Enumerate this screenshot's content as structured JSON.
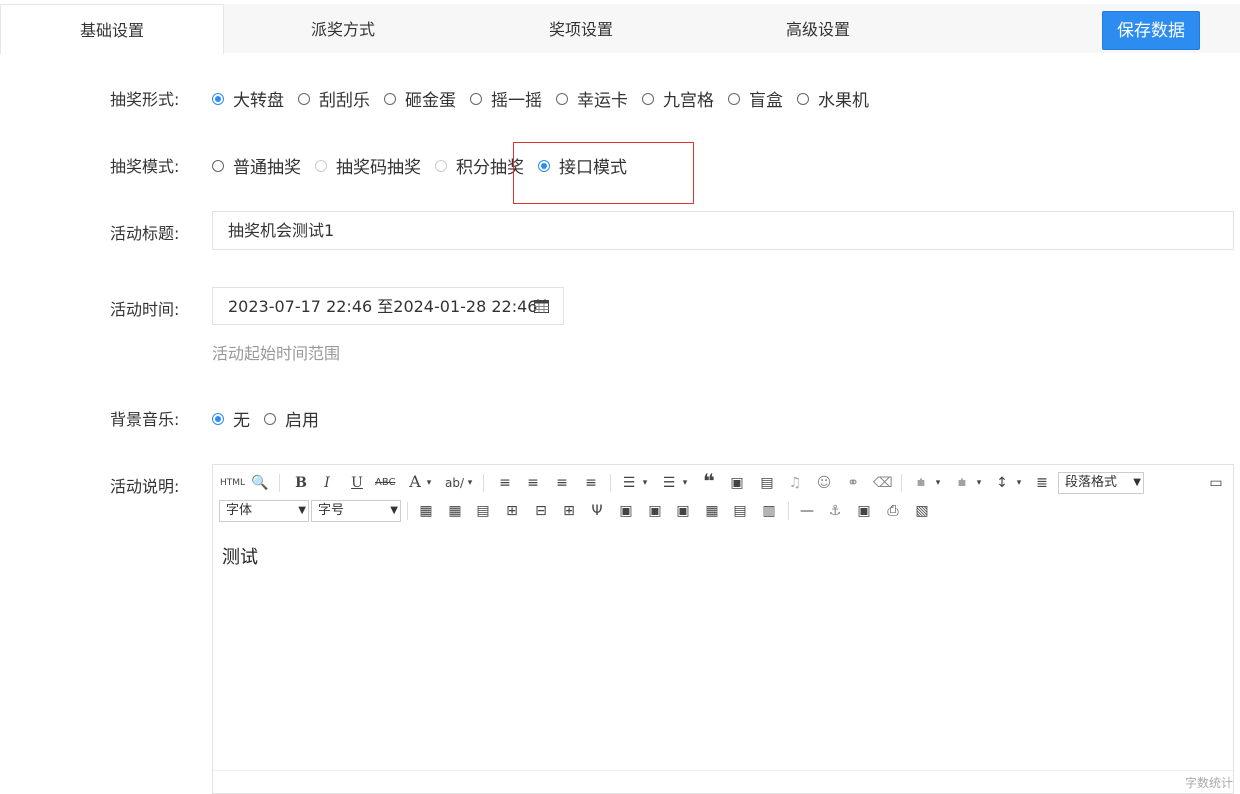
{
  "tabs": [
    "基础设置",
    "派奖方式",
    "奖项设置",
    "高级设置"
  ],
  "save_label": "保存数据",
  "form": {
    "lottery_form": {
      "label": "抽奖形式:",
      "options": [
        "大转盘",
        "刮刮乐",
        "砸金蛋",
        "摇一摇",
        "幸运卡",
        "九宫格",
        "盲盒",
        "水果机"
      ],
      "selected": "大转盘"
    },
    "lottery_mode": {
      "label": "抽奖模式:",
      "options": [
        "普通抽奖",
        "抽奖码抽奖",
        "积分抽奖",
        "接口模式"
      ],
      "selected": "接口模式"
    },
    "title": {
      "label": "活动标题:",
      "value": "抽奖机会测试1"
    },
    "time": {
      "label": "活动时间:",
      "value": "2023-07-17 22:46 至2024-01-28 22:46",
      "hint": "活动起始时间范围"
    },
    "music": {
      "label": "背景音乐:",
      "options": [
        "无",
        "启用"
      ],
      "selected": "无"
    },
    "description": {
      "label": "活动说明:",
      "content": "测试"
    }
  },
  "editor": {
    "paragraph_select": "段落格式",
    "font_select": "字体",
    "size_select": "字号",
    "word_count": "字数统计"
  },
  "colors": {
    "accent": "#2d8cf0",
    "highlight_box": "#d33333"
  }
}
